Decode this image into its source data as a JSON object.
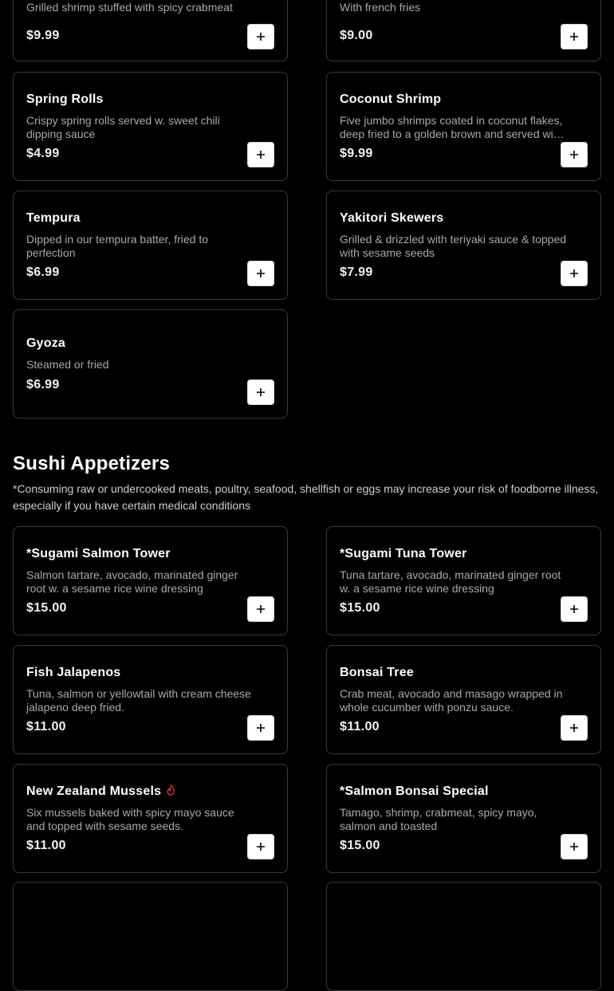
{
  "sections": {
    "appetizers_partial": {
      "items": [
        {
          "name": "",
          "description": "Grilled shrimp stuffed with spicy crabmeat",
          "price": "$9.99"
        },
        {
          "name": "",
          "description": "With french fries",
          "price": "$9.00"
        },
        {
          "name": "Spring Rolls",
          "description": "Crispy spring rolls served w. sweet chili dipping sauce",
          "price": "$4.99"
        },
        {
          "name": "Coconut Shrimp",
          "description": "Five jumbo shrimps coated in coconut flakes, deep fried to a golden brown and served with sweet chili sauce",
          "price": "$9.99"
        },
        {
          "name": "Tempura",
          "description": "Dipped in our tempura batter, fried to perfection",
          "price": "$6.99"
        },
        {
          "name": "Yakitori Skewers",
          "description": "Grilled & drizzled with teriyaki sauce & topped with sesame seeds",
          "price": "$7.99"
        },
        {
          "name": "Gyoza",
          "description": "Steamed or fried",
          "price": "$6.99"
        }
      ]
    },
    "sushi_appetizers": {
      "title": "Sushi Appetizers",
      "note": "*Consuming raw or undercooked meats, poultry, seafood, shellfish or eggs may increase your risk of foodborne illness, especially if you have certain medical conditions",
      "items": [
        {
          "name": "*Sugami Salmon Tower",
          "description": "Salmon tartare, avocado, marinated ginger root w. a sesame rice wine dressing",
          "price": "$15.00"
        },
        {
          "name": "*Sugami Tuna Tower",
          "description": "Tuna tartare, avocado, marinated ginger root w. a sesame rice wine dressing",
          "price": "$15.00"
        },
        {
          "name": "Fish Jalapenos",
          "description": "Tuna, salmon or yellowtail with cream cheese jalapeno deep fried.",
          "price": "$11.00"
        },
        {
          "name": "Bonsai Tree",
          "description": "Crab meat, avocado and masago wrapped in whole cucumber with ponzu sauce.",
          "price": "$11.00"
        },
        {
          "name": "New Zealand Mussels",
          "description": "Six mussels baked with spicy mayo sauce and topped with sesame seeds.",
          "price": "$11.00",
          "icon": "spicy-flame-icon"
        },
        {
          "name": "*Salmon Bonsai Special",
          "description": "Tamago, shrimp, crabmeat, spicy mayo, salmon and toasted",
          "price": "$15.00"
        }
      ]
    }
  },
  "colors": {
    "background": "#000000",
    "card_border": "#3a3a3a",
    "accent_flame": "#e0342b"
  }
}
